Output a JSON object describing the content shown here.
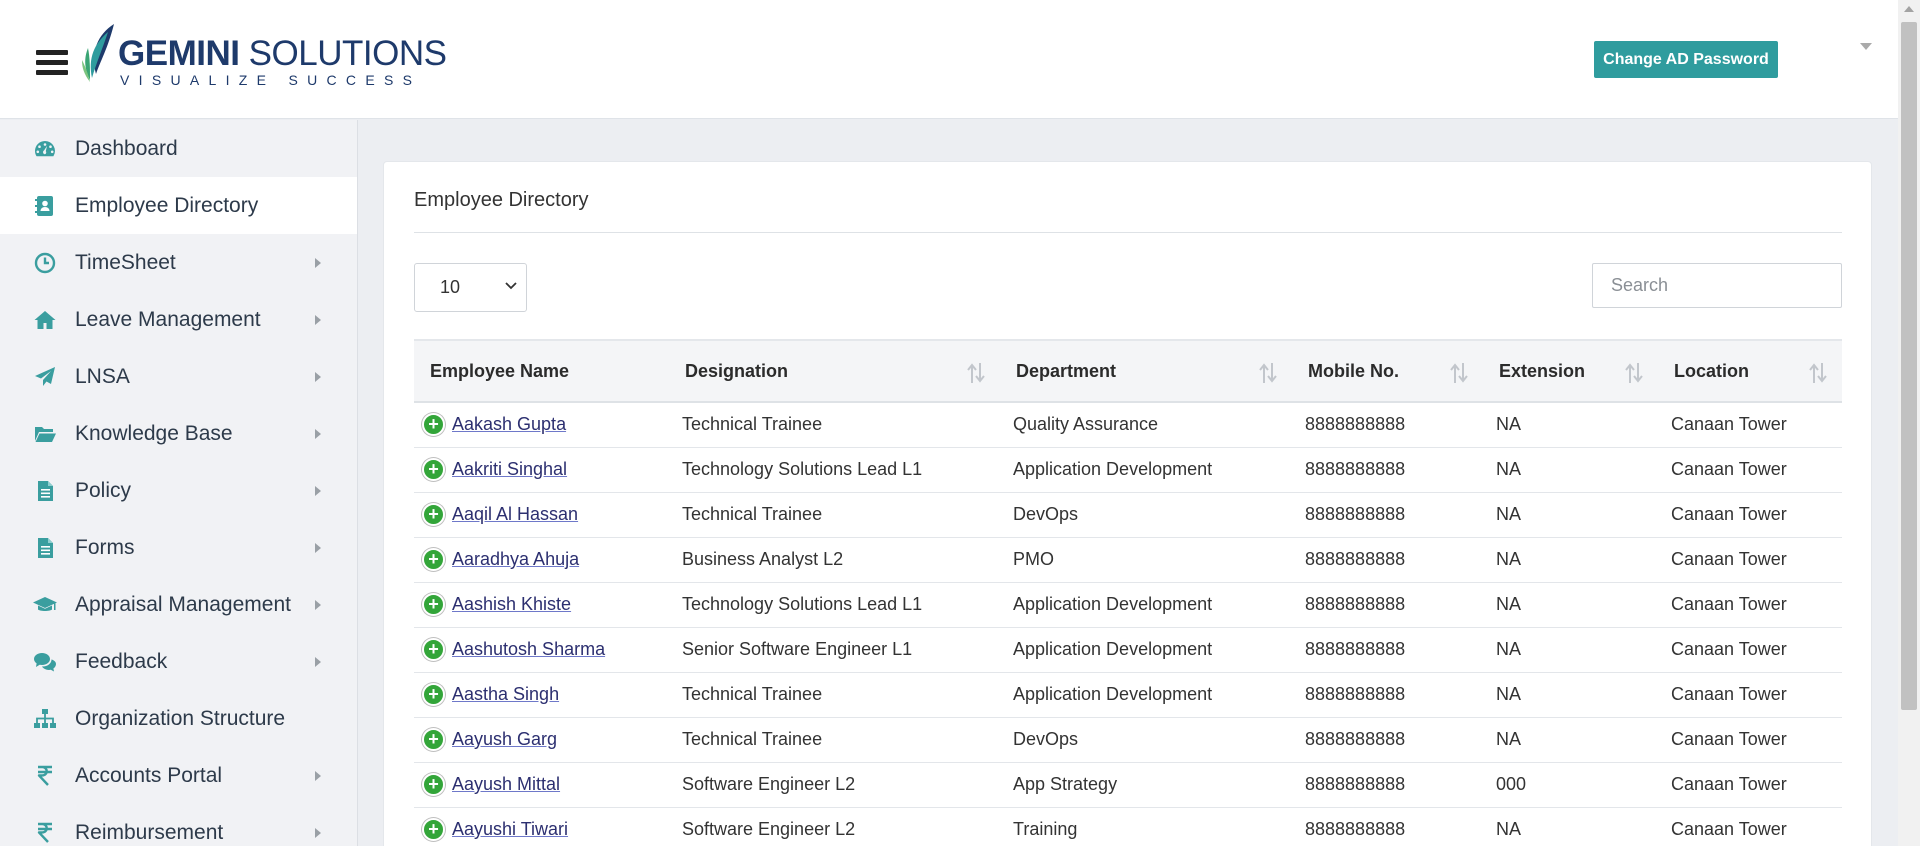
{
  "header": {
    "logo_brand_bold": "GEMINI",
    "logo_brand_rest": " SOLUTIONS",
    "logo_tagline": "VISUALIZE SUCCESS",
    "change_password_label": "Change AD Password"
  },
  "colors": {
    "accent": "#2f9c9e",
    "brand_navy": "#1e3a6b",
    "plus_green": "#33a539",
    "sidebar_bg": "#f1f2f5"
  },
  "sidebar": {
    "items": [
      {
        "label": "Dashboard",
        "icon": "dashboard-icon",
        "has_submenu": false,
        "active": false
      },
      {
        "label": "Employee Directory",
        "icon": "address-book-icon",
        "has_submenu": false,
        "active": true
      },
      {
        "label": "TimeSheet",
        "icon": "clock-icon",
        "has_submenu": true,
        "active": false
      },
      {
        "label": "Leave Management",
        "icon": "home-icon",
        "has_submenu": true,
        "active": false
      },
      {
        "label": "LNSA",
        "icon": "paper-plane-icon",
        "has_submenu": true,
        "active": false
      },
      {
        "label": "Knowledge Base",
        "icon": "folder-open-icon",
        "has_submenu": true,
        "active": false
      },
      {
        "label": "Policy",
        "icon": "document-icon",
        "has_submenu": true,
        "active": false
      },
      {
        "label": "Forms",
        "icon": "document-icon",
        "has_submenu": true,
        "active": false
      },
      {
        "label": "Appraisal Management",
        "icon": "graduation-cap-icon",
        "has_submenu": true,
        "active": false
      },
      {
        "label": "Feedback",
        "icon": "comments-icon",
        "has_submenu": true,
        "active": false
      },
      {
        "label": "Organization Structure",
        "icon": "sitemap-icon",
        "has_submenu": false,
        "active": false
      },
      {
        "label": "Accounts Portal",
        "icon": "rupee-icon",
        "has_submenu": true,
        "active": false
      },
      {
        "label": "Reimbursement",
        "icon": "rupee-icon",
        "has_submenu": true,
        "active": false
      }
    ]
  },
  "main": {
    "title": "Employee Directory",
    "page_size": "10",
    "search_placeholder": "Search",
    "columns": [
      "Employee Name",
      "Designation",
      "Department",
      "Mobile No.",
      "Extension",
      "Location"
    ],
    "rows": [
      {
        "name": "Aakash Gupta",
        "designation": "Technical Trainee",
        "department": "Quality Assurance",
        "mobile": "8888888888",
        "extension": "NA",
        "location": "Canaan Tower"
      },
      {
        "name": "Aakriti Singhal",
        "designation": "Technology Solutions Lead L1",
        "department": "Application Development",
        "mobile": "8888888888",
        "extension": "NA",
        "location": "Canaan Tower"
      },
      {
        "name": "Aaqil Al Hassan",
        "designation": "Technical Trainee",
        "department": "DevOps",
        "mobile": "8888888888",
        "extension": "NA",
        "location": "Canaan Tower"
      },
      {
        "name": "Aaradhya Ahuja",
        "designation": "Business Analyst L2",
        "department": "PMO",
        "mobile": "8888888888",
        "extension": "NA",
        "location": "Canaan Tower"
      },
      {
        "name": "Aashish Khiste",
        "designation": "Technology Solutions Lead L1",
        "department": "Application Development",
        "mobile": "8888888888",
        "extension": "NA",
        "location": "Canaan Tower"
      },
      {
        "name": "Aashutosh Sharma",
        "designation": "Senior Software Engineer L1",
        "department": "Application Development",
        "mobile": "8888888888",
        "extension": "NA",
        "location": "Canaan Tower"
      },
      {
        "name": "Aastha Singh",
        "designation": "Technical Trainee",
        "department": "Application Development",
        "mobile": "8888888888",
        "extension": "NA",
        "location": "Canaan Tower"
      },
      {
        "name": "Aayush Garg",
        "designation": "Technical Trainee",
        "department": "DevOps",
        "mobile": "8888888888",
        "extension": "NA",
        "location": "Canaan Tower"
      },
      {
        "name": "Aayush Mittal",
        "designation": "Software Engineer L2",
        "department": "App Strategy",
        "mobile": "8888888888",
        "extension": "000",
        "location": "Canaan Tower"
      },
      {
        "name": "Aayushi Tiwari",
        "designation": "Software Engineer L2",
        "department": "Training",
        "mobile": "8888888888",
        "extension": "NA",
        "location": "Canaan Tower"
      }
    ]
  }
}
